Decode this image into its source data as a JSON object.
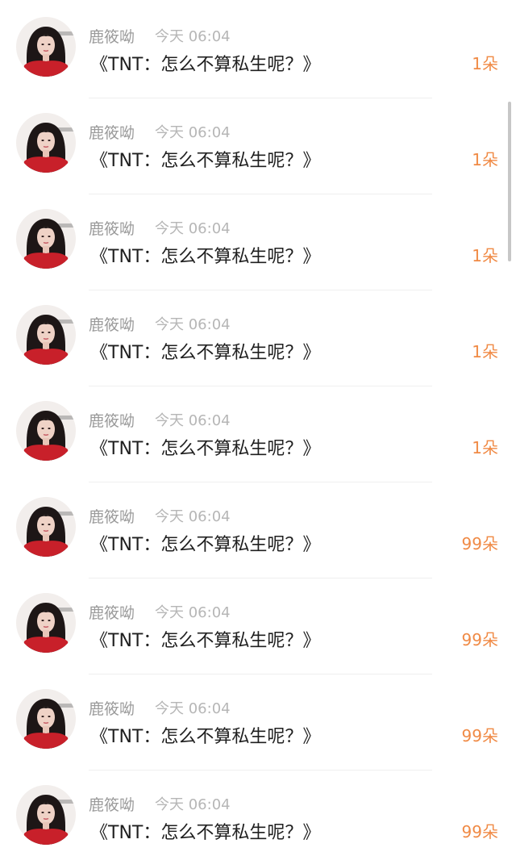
{
  "messages": [
    {
      "username": "鹿筱呦",
      "time": "今天 06:04",
      "text": "《TNT：怎么不算私生呢？》",
      "gift": "1朵"
    },
    {
      "username": "鹿筱呦",
      "time": "今天 06:04",
      "text": "《TNT：怎么不算私生呢？》",
      "gift": "1朵"
    },
    {
      "username": "鹿筱呦",
      "time": "今天 06:04",
      "text": "《TNT：怎么不算私生呢？》",
      "gift": "1朵"
    },
    {
      "username": "鹿筱呦",
      "time": "今天 06:04",
      "text": "《TNT：怎么不算私生呢？》",
      "gift": "1朵"
    },
    {
      "username": "鹿筱呦",
      "time": "今天 06:04",
      "text": "《TNT：怎么不算私生呢？》",
      "gift": "1朵"
    },
    {
      "username": "鹿筱呦",
      "time": "今天 06:04",
      "text": "《TNT：怎么不算私生呢？》",
      "gift": "99朵"
    },
    {
      "username": "鹿筱呦",
      "time": "今天 06:04",
      "text": "《TNT：怎么不算私生呢？》",
      "gift": "99朵"
    },
    {
      "username": "鹿筱呦",
      "time": "今天 06:04",
      "text": "《TNT：怎么不算私生呢？》",
      "gift": "99朵"
    },
    {
      "username": "鹿筱呦",
      "time": "今天 06:04",
      "text": "《TNT：怎么不算私生呢？》",
      "gift": "99朵"
    }
  ],
  "colors": {
    "gift_accent": "#f08a45",
    "username": "#9a9a9a",
    "timestamp": "#b6b6b6",
    "message": "#1f1f1f"
  },
  "icons": {
    "avatar": "user-avatar-icon"
  }
}
